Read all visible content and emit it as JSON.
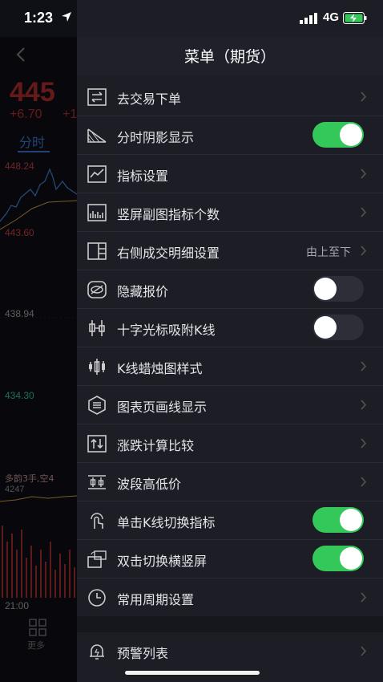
{
  "status": {
    "time": "1:23",
    "network": "4G"
  },
  "background": {
    "price": "445",
    "change": "+6.70",
    "change_pct": "+1",
    "tab": "分时",
    "levels": [
      "448.24",
      "443.60",
      "438.94",
      "434.30"
    ],
    "volume_label": "多韵3手,空4",
    "volume_value": "4247",
    "time_end": "21:00",
    "more": "更多"
  },
  "menu": {
    "title": "菜单（期货）",
    "items": [
      {
        "label": "去交易下单",
        "icon": "exchange-icon",
        "control": "chevron"
      },
      {
        "label": "分时阴影显示",
        "icon": "shadow-icon",
        "control": "toggle",
        "on": true
      },
      {
        "label": "指标设置",
        "icon": "indicator-icon",
        "control": "chevron"
      },
      {
        "label": "竖屏副图指标个数",
        "icon": "subchart-icon",
        "control": "chevron"
      },
      {
        "label": "右侧成交明细设置",
        "icon": "panel-right-icon",
        "control": "chevron",
        "value": "由上至下"
      },
      {
        "label": "隐藏报价",
        "icon": "eye-hidden-icon",
        "control": "toggle",
        "on": false
      },
      {
        "label": "十字光标吸附K线",
        "icon": "crosshair-candle-icon",
        "control": "toggle",
        "on": false
      },
      {
        "label": "K线蜡烛图样式",
        "icon": "candlestick-icon",
        "control": "chevron"
      },
      {
        "label": "图表页画线显示",
        "icon": "hexagon-lines-icon",
        "control": "chevron"
      },
      {
        "label": "涨跌计算比较",
        "icon": "updown-icon",
        "control": "chevron"
      },
      {
        "label": "波段高低价",
        "icon": "band-icon",
        "control": "chevron"
      },
      {
        "label": "单击K线切换指标",
        "icon": "tap-icon",
        "control": "toggle",
        "on": true
      },
      {
        "label": "双击切换横竖屏",
        "icon": "rotate-icon",
        "control": "toggle",
        "on": true
      },
      {
        "label": "常用周期设置",
        "icon": "clock-icon",
        "control": "chevron"
      }
    ],
    "extra": {
      "label": "预警列表",
      "icon": "alarm-icon",
      "control": "chevron"
    }
  },
  "colors": {
    "toggle_on": "#34c75a",
    "price_red": "#b8312f",
    "accent_blue": "#3d7ad8"
  }
}
